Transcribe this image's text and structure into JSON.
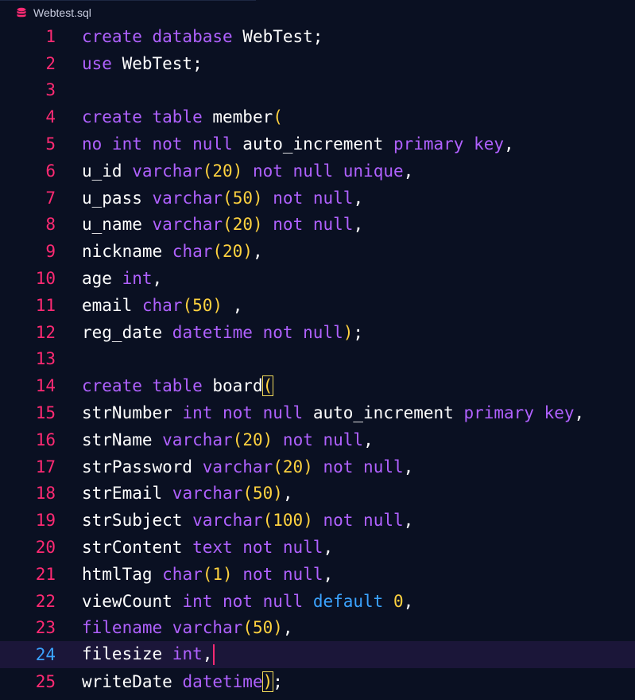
{
  "tab": {
    "filename": "Webtest.sql",
    "icon": "database-icon"
  },
  "editor": {
    "current_line": 24,
    "lines": [
      {
        "n": "1",
        "t": [
          [
            "kw",
            "create database "
          ],
          [
            "p",
            "WebTest;"
          ]
        ]
      },
      {
        "n": "2",
        "t": [
          [
            "kw",
            "use "
          ],
          [
            "p",
            "WebTest;"
          ]
        ]
      },
      {
        "n": "3",
        "t": []
      },
      {
        "n": "4",
        "t": [
          [
            "kw",
            "create table "
          ],
          [
            "p",
            "member"
          ],
          [
            "paren",
            "("
          ]
        ]
      },
      {
        "n": "5",
        "t": [
          [
            "kw",
            "no int not null "
          ],
          [
            "p",
            "auto_increment "
          ],
          [
            "kw",
            "primary key"
          ],
          [
            "p",
            ","
          ]
        ]
      },
      {
        "n": "6",
        "t": [
          [
            "p",
            "u_id "
          ],
          [
            "kw",
            "varchar"
          ],
          [
            "paren",
            "("
          ],
          [
            "num",
            "20"
          ],
          [
            "paren",
            ")"
          ],
          [
            "kw",
            " not null unique"
          ],
          [
            "p",
            ","
          ]
        ]
      },
      {
        "n": "7",
        "t": [
          [
            "p",
            "u_pass "
          ],
          [
            "kw",
            "varchar"
          ],
          [
            "paren",
            "("
          ],
          [
            "num",
            "50"
          ],
          [
            "paren",
            ")"
          ],
          [
            "kw",
            " not null"
          ],
          [
            "p",
            ","
          ]
        ]
      },
      {
        "n": "8",
        "t": [
          [
            "p",
            "u_name "
          ],
          [
            "kw",
            "varchar"
          ],
          [
            "paren",
            "("
          ],
          [
            "num",
            "20"
          ],
          [
            "paren",
            ")"
          ],
          [
            "kw",
            " not null"
          ],
          [
            "p",
            ","
          ]
        ]
      },
      {
        "n": "9",
        "t": [
          [
            "p",
            "nickname "
          ],
          [
            "kw",
            "char"
          ],
          [
            "paren",
            "("
          ],
          [
            "num",
            "20"
          ],
          [
            "paren",
            ")"
          ],
          [
            "p",
            ","
          ]
        ]
      },
      {
        "n": "10",
        "t": [
          [
            "p",
            "age "
          ],
          [
            "kw",
            "int"
          ],
          [
            "p",
            ","
          ]
        ]
      },
      {
        "n": "11",
        "t": [
          [
            "p",
            "email "
          ],
          [
            "kw",
            "char"
          ],
          [
            "paren",
            "("
          ],
          [
            "num",
            "50"
          ],
          [
            "paren",
            ")"
          ],
          [
            "p",
            " ,"
          ]
        ]
      },
      {
        "n": "12",
        "t": [
          [
            "p",
            "reg_date "
          ],
          [
            "kw",
            "datetime not null"
          ],
          [
            "paren",
            ")"
          ],
          [
            "p",
            ";"
          ]
        ]
      },
      {
        "n": "13",
        "t": []
      },
      {
        "n": "14",
        "t": [
          [
            "kw",
            "create table "
          ],
          [
            "p",
            "board"
          ],
          [
            "match",
            "("
          ]
        ]
      },
      {
        "n": "15",
        "t": [
          [
            "p",
            "strNumber "
          ],
          [
            "kw",
            "int not null "
          ],
          [
            "p",
            "auto_increment "
          ],
          [
            "kw",
            "primary key"
          ],
          [
            "p",
            ","
          ]
        ]
      },
      {
        "n": "16",
        "t": [
          [
            "p",
            "strName "
          ],
          [
            "kw",
            "varchar"
          ],
          [
            "paren",
            "("
          ],
          [
            "num",
            "20"
          ],
          [
            "paren",
            ")"
          ],
          [
            "kw",
            " not null"
          ],
          [
            "p",
            ","
          ]
        ]
      },
      {
        "n": "17",
        "t": [
          [
            "p",
            "strPassword "
          ],
          [
            "kw",
            "varchar"
          ],
          [
            "paren",
            "("
          ],
          [
            "num",
            "20"
          ],
          [
            "paren",
            ")"
          ],
          [
            "kw",
            " not null"
          ],
          [
            "p",
            ","
          ]
        ]
      },
      {
        "n": "18",
        "t": [
          [
            "p",
            "strEmail "
          ],
          [
            "kw",
            "varchar"
          ],
          [
            "paren",
            "("
          ],
          [
            "num",
            "50"
          ],
          [
            "paren",
            ")"
          ],
          [
            "p",
            ","
          ]
        ]
      },
      {
        "n": "19",
        "t": [
          [
            "p",
            "strSubject "
          ],
          [
            "kw",
            "varchar"
          ],
          [
            "paren",
            "("
          ],
          [
            "num",
            "100"
          ],
          [
            "paren",
            ")"
          ],
          [
            "kw",
            " not null"
          ],
          [
            "p",
            ","
          ]
        ]
      },
      {
        "n": "20",
        "t": [
          [
            "p",
            "strContent "
          ],
          [
            "kw",
            "text not null"
          ],
          [
            "p",
            ","
          ]
        ]
      },
      {
        "n": "21",
        "t": [
          [
            "p",
            "htmlTag "
          ],
          [
            "kw",
            "char"
          ],
          [
            "paren",
            "("
          ],
          [
            "num",
            "1"
          ],
          [
            "paren",
            ")"
          ],
          [
            "kw",
            " not null"
          ],
          [
            "p",
            ","
          ]
        ]
      },
      {
        "n": "22",
        "t": [
          [
            "p",
            "viewCount "
          ],
          [
            "kw",
            "int not null "
          ],
          [
            "blue",
            "default "
          ],
          [
            "num",
            "0"
          ],
          [
            "p",
            ","
          ]
        ]
      },
      {
        "n": "23",
        "t": [
          [
            "kw",
            "filename "
          ],
          [
            "kw",
            "varchar"
          ],
          [
            "paren",
            "("
          ],
          [
            "num",
            "50"
          ],
          [
            "paren",
            ")"
          ],
          [
            "p",
            ","
          ]
        ]
      },
      {
        "n": "24",
        "t": [
          [
            "p",
            "filesize "
          ],
          [
            "kw",
            "int"
          ],
          [
            "p",
            ","
          ]
        ]
      },
      {
        "n": "25",
        "t": [
          [
            "p",
            "writeDate "
          ],
          [
            "kw",
            "datetime"
          ],
          [
            "match",
            ")"
          ],
          [
            "p",
            ";"
          ]
        ]
      }
    ]
  },
  "colors": {
    "background": "#0a1022",
    "line_number": "#ff2a73",
    "current_line_number": "#3ba3ff",
    "keyword": "#b061ff",
    "number": "#ffd23f",
    "plain": "#ffffff",
    "current_line_bg": "#1b1639",
    "cursor": "#ff2a73"
  }
}
